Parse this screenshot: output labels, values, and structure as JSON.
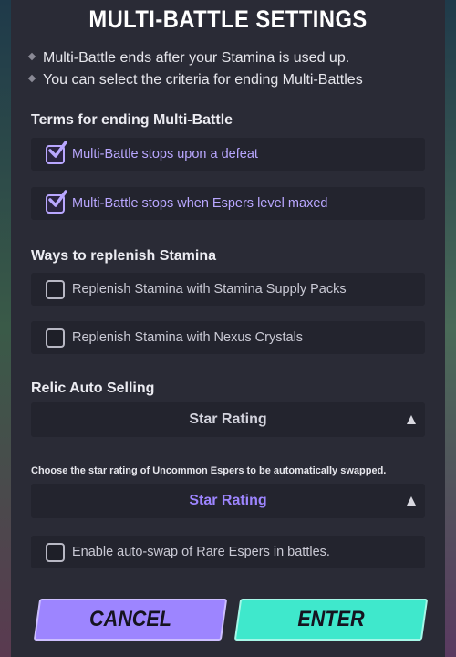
{
  "title": "MULTI-BATTLE SETTINGS",
  "info_lines": [
    "Multi-Battle ends after your Stamina is used up.",
    "You can select the criteria for ending Multi-Battles"
  ],
  "terms_section": {
    "label": "Terms for ending Multi-Battle",
    "options": [
      {
        "label": "Multi-Battle stops upon a defeat",
        "checked": true
      },
      {
        "label": "Multi-Battle stops when Espers level maxed",
        "checked": true
      }
    ]
  },
  "stamina_section": {
    "label": "Ways to replenish Stamina",
    "options": [
      {
        "label": "Replenish Stamina with Stamina Supply Packs",
        "checked": false
      },
      {
        "label": "Replenish Stamina with Nexus Crystals",
        "checked": false
      }
    ]
  },
  "relic_section": {
    "label": "Relic Auto Selling",
    "dropdown_value": "Star Rating"
  },
  "uncommon_swap": {
    "hint": "Choose the star rating of Uncommon Espers to be automatically swapped.",
    "dropdown_value": "Star Rating"
  },
  "rare_swap": {
    "label": "Enable auto-swap of Rare Espers in battles.",
    "checked": false
  },
  "buttons": {
    "cancel": "CANCEL",
    "enter": "ENTER"
  },
  "colors": {
    "accent_purple": "#9d85ff",
    "accent_teal": "#3fe8cc",
    "checked_text": "#b9a7ff",
    "panel_bg": "#2a2b36"
  }
}
